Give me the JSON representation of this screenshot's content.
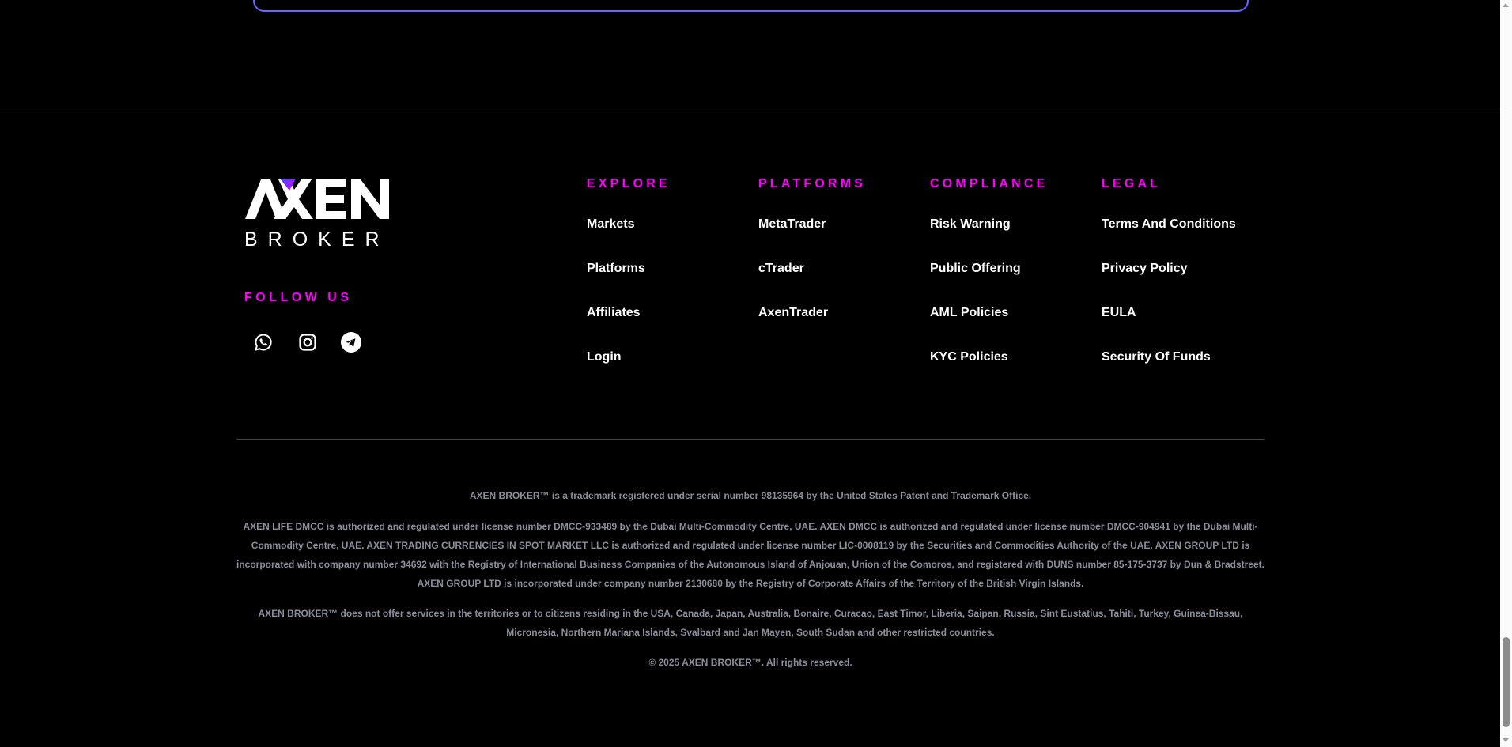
{
  "logo": {
    "word": "AXEN",
    "sub": "BROKER"
  },
  "follow_us": "FOLLOW US",
  "social": [
    "whatsapp-icon",
    "instagram-icon",
    "telegram-icon"
  ],
  "columns": [
    {
      "title": "EXPLORE",
      "links": [
        "Markets",
        "Platforms",
        "Affiliates",
        "Login"
      ]
    },
    {
      "title": "PLATFORMS",
      "links": [
        "MetaTrader",
        "cTrader",
        "AxenTrader"
      ]
    },
    {
      "title": "COMPLIANCE",
      "links": [
        "Risk Warning",
        "Public Offering",
        "AML Policies",
        "KYC Policies"
      ]
    },
    {
      "title": "LEGAL",
      "links": [
        "Terms And Conditions",
        "Privacy Policy",
        "EULA",
        "Security Of Funds"
      ]
    }
  ],
  "legal": {
    "trademark": "AXEN BROKER™ is a trademark registered under serial number 98135964 by the United States Patent and Trademark Office.",
    "regulation": "AXEN LIFE DMCC is authorized and regulated under license number DMCC-933489 by the Dubai Multi-Commodity Centre, UAE. AXEN DMCC is authorized and regulated under license number DMCC-904941 by the Dubai Multi-Commodity Centre, UAE. AXEN TRADING CURRENCIES IN SPOT MARKET LLC is authorized and regulated under license number LIC-0008119 by the Securities and Commodities Authority of the UAE. AXEN GROUP LTD is incorporated with company number 34692 with the Registry of International Business Companies of the Autonomous Island of Anjouan, Union of the Comoros, and registered with DUNS number 85-175-3737 by Dun & Bradstreet. AXEN GROUP LTD is incorporated under company number 2130680 by the Registry of Corporate Affairs of the Territory of the British Virgin Islands.",
    "restrictions": "AXEN BROKER™ does not offer services in the territories or to citizens residing in the USA, Canada, Japan, Australia, Bonaire, Curacao, East Timor, Liberia, Saipan, Russia, Sint Eustatius, Tahiti, Turkey, Guinea-Bissau, Micronesia, Northern Mariana Islands, Svalbard and Jan Mayen, South Sudan and other restricted countries.",
    "copyright": "© 2025 AXEN BROKER™. All rights reserved."
  },
  "colors": {
    "accent": "#ff00ff",
    "card_border": "#6a63ff",
    "legal_text": "#8a8e9c"
  }
}
